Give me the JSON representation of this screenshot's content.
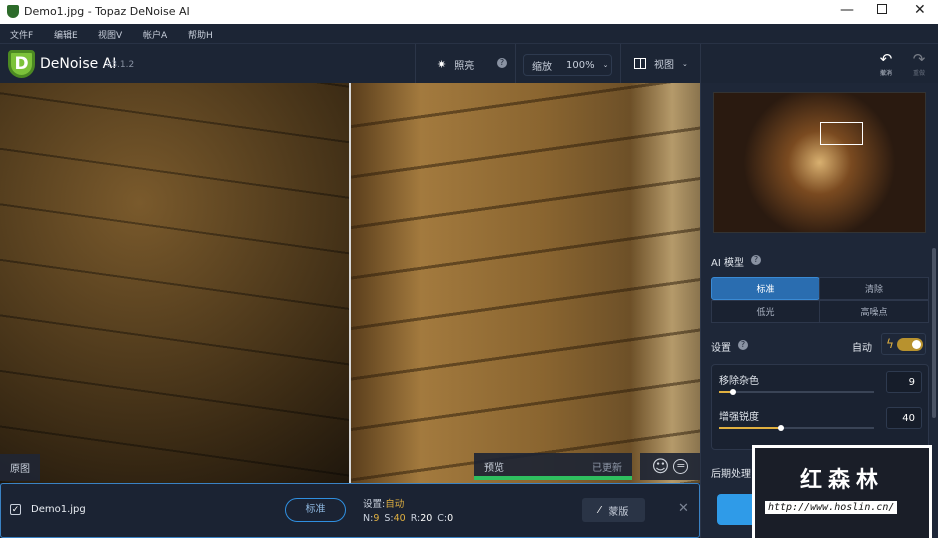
{
  "window": {
    "title": "Demo1.jpg - Topaz DeNoise AI"
  },
  "menu": [
    {
      "label": "文件F"
    },
    {
      "label": "编辑E"
    },
    {
      "label": "视图V"
    },
    {
      "label": "帐户A"
    },
    {
      "label": "帮助H"
    }
  ],
  "app": {
    "name": "DeNoise AI",
    "version": "v3.1.2"
  },
  "toolbar": {
    "brighten": "照亮",
    "zoom_label": "缩放",
    "zoom_value": "100%",
    "view": "视图",
    "undo": "撤消",
    "redo": "重做"
  },
  "viewer": {
    "original_label": "原图",
    "preview_label": "预览",
    "preview_status": "已更新",
    "preview_progress": 100
  },
  "panel": {
    "ai_model": "AI 模型",
    "models": [
      {
        "label": "标准",
        "selected": true
      },
      {
        "label": "清除"
      },
      {
        "label": "低光"
      },
      {
        "label": "高噪点"
      }
    ],
    "settings": "设置",
    "auto": "自动",
    "auto_on": true,
    "sliders": [
      {
        "label": "移除杂色",
        "value": "9",
        "max": 100
      },
      {
        "label": "增强锐度",
        "value": "40",
        "max": 100
      }
    ],
    "post": "后期处理"
  },
  "watermark": {
    "text": "红森林",
    "url": "http://www.hoslin.cn/"
  },
  "strip": {
    "filename": "Demo1.jpg",
    "checked": true,
    "model": "标准",
    "settings_label": "设置:",
    "settings_value": "自动",
    "params": [
      {
        "k": "N:",
        "v": "9",
        "hl": true
      },
      {
        "k": "S:",
        "v": "40",
        "hl": true
      },
      {
        "k": "R:",
        "v": "20"
      },
      {
        "k": "C:",
        "v": "0"
      }
    ],
    "mask": "蒙版"
  },
  "colors": {
    "accent": "#2f8fe0",
    "gold": "#e0b040",
    "green": "#2fbf5f"
  }
}
